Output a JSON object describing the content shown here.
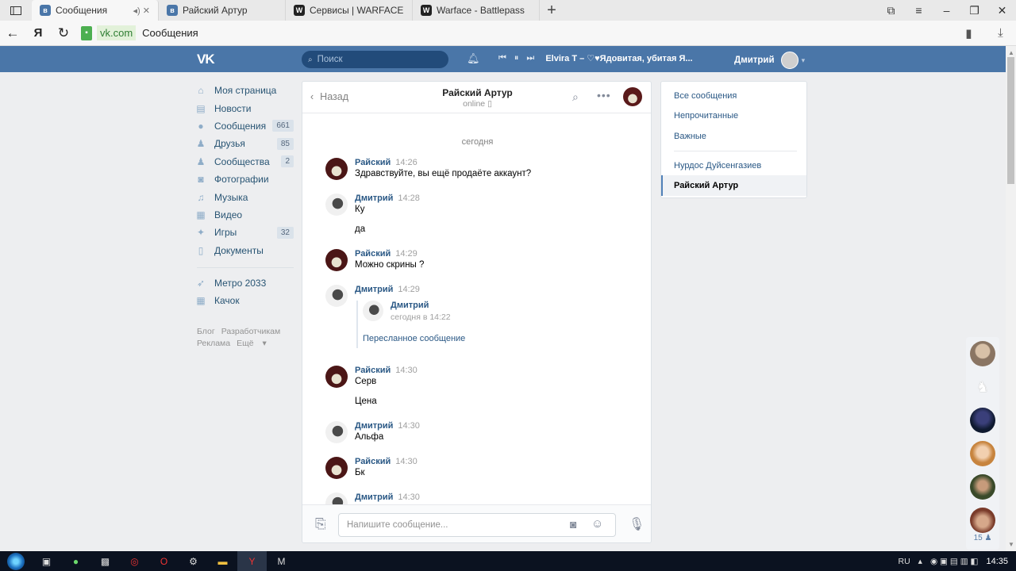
{
  "browser": {
    "tabs": [
      {
        "label": "Сообщения",
        "favicon": "vk",
        "active": true
      },
      {
        "label": "Райский Артур",
        "favicon": "vk",
        "active": false
      },
      {
        "label": "Сервисы | WARFACE",
        "favicon": "wf",
        "active": false
      },
      {
        "label": "Warface - Battlepass",
        "favicon": "wf",
        "active": false
      }
    ],
    "new_tab": "+",
    "domain": "vk.com",
    "page_title": "Сообщения",
    "yandex_button": "Я"
  },
  "vk": {
    "logo": "VK",
    "search_placeholder": "Поиск",
    "player_track": "Elvira T – ♡♥Ядовитая, убитая Я...",
    "user_name": "Дмитрий"
  },
  "menu": {
    "items": [
      {
        "label": "Моя страница",
        "icon": "home-icon",
        "count": ""
      },
      {
        "label": "Новости",
        "icon": "news-icon",
        "count": ""
      },
      {
        "label": "Сообщения",
        "icon": "messages-icon",
        "count": "661"
      },
      {
        "label": "Друзья",
        "icon": "friends-icon",
        "count": "85"
      },
      {
        "label": "Сообщества",
        "icon": "groups-icon",
        "count": "2"
      },
      {
        "label": "Фотографии",
        "icon": "camera-icon",
        "count": ""
      },
      {
        "label": "Музыка",
        "icon": "music-icon",
        "count": ""
      },
      {
        "label": "Видео",
        "icon": "video-icon",
        "count": ""
      },
      {
        "label": "Игры",
        "icon": "games-icon",
        "count": "32"
      },
      {
        "label": "Документы",
        "icon": "docs-icon",
        "count": ""
      }
    ],
    "apps": [
      {
        "label": "Метро 2033",
        "icon": "rocket-icon"
      },
      {
        "label": "Качок",
        "icon": "grid-icon"
      }
    ],
    "footer": {
      "blog": "Блог",
      "dev": "Разработчикам",
      "ads": "Реклама",
      "more": "Ещё"
    }
  },
  "chat": {
    "back_label": "Назад",
    "title": "Райский Артур",
    "status": "online",
    "day": "сегодня",
    "messages": [
      {
        "name": "Райский",
        "time": "14:26",
        "lines": [
          "Здравствуйте, вы ещё продаёте аккаунт?"
        ],
        "who": "artur"
      },
      {
        "name": "Дмитрий",
        "time": "14:28",
        "lines": [
          "Ку",
          "да"
        ],
        "who": "dmitry"
      },
      {
        "name": "Райский",
        "time": "14:29",
        "lines": [
          "Можно скрины ?"
        ],
        "who": "artur"
      },
      {
        "name": "Дмитрий",
        "time": "14:29",
        "lines": [],
        "who": "dmitry"
      },
      {
        "name": "Райский",
        "time": "14:30",
        "lines": [
          "Серв",
          "Цена"
        ],
        "who": "artur"
      },
      {
        "name": "Дмитрий",
        "time": "14:30",
        "lines": [
          "Альфа"
        ],
        "who": "dmitry"
      },
      {
        "name": "Райский",
        "time": "14:30",
        "lines": [
          "Бк"
        ],
        "who": "artur"
      },
      {
        "name": "Дмитрий",
        "time": "14:30",
        "lines": [],
        "who": "dmitry"
      }
    ],
    "forwarded": {
      "name": "Дмитрий",
      "date": "сегодня в 14:22",
      "link": "Пересланное сообщение"
    },
    "composer_placeholder": "Напишите сообщение..."
  },
  "filters": {
    "items": [
      "Все сообщения",
      "Непрочитанные",
      "Важные"
    ],
    "dialogs": [
      "Нурдос Дуйсенгазиев",
      "Райский Артур"
    ]
  },
  "friends_online": {
    "count": "15"
  },
  "taskbar": {
    "lang": "RU",
    "time": "14:35"
  }
}
